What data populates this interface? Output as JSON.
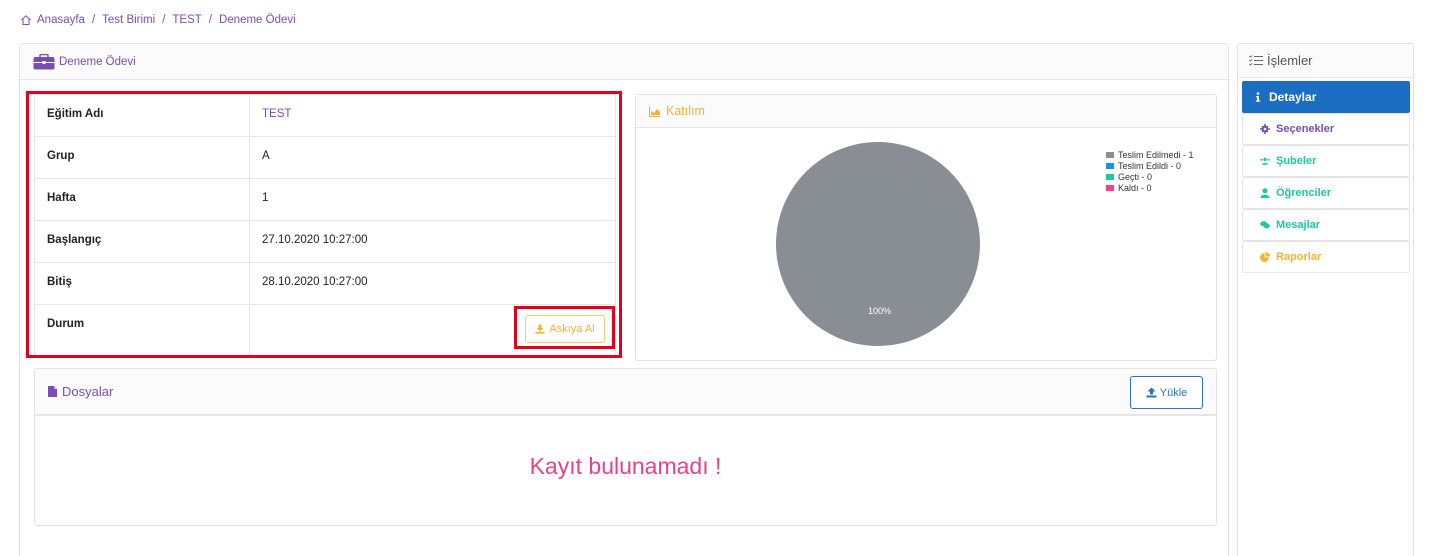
{
  "breadcrumb": {
    "items": [
      "Anasayfa",
      "Test Birimi",
      "TEST",
      "Deneme Ödevi"
    ],
    "separator": "/"
  },
  "main": {
    "title": "Deneme Ödevi",
    "details": [
      {
        "label": "Eğitim Adı",
        "value": "TEST"
      },
      {
        "label": "Grup",
        "value": "A"
      },
      {
        "label": "Hafta",
        "value": "1"
      },
      {
        "label": "Başlangıç",
        "value": "27.10.2020 10:27:00"
      },
      {
        "label": "Bitiş",
        "value": "28.10.2020 10:27:00"
      },
      {
        "label": "Durum",
        "value": ""
      }
    ],
    "suspend_button": "Askıya Al"
  },
  "participation": {
    "title": "Katılım",
    "pie_label": "100%",
    "legend": [
      {
        "label": "Teslim Edilmedi - 1",
        "color": "#888e93"
      },
      {
        "label": "Teslim Edildi - 0",
        "color": "#1e8ff0"
      },
      {
        "label": "Geçti - 0",
        "color": "#1ec8a0"
      },
      {
        "label": "Kaldı - 0",
        "color": "#f43e9c"
      }
    ]
  },
  "chart_data": {
    "type": "pie",
    "categories": [
      "Teslim Edilmedi",
      "Teslim Edildi",
      "Geçti",
      "Kaldı"
    ],
    "values": [
      1,
      0,
      0,
      0
    ],
    "title": "Katılım",
    "legend_position": "top-right"
  },
  "files": {
    "title": "Dosyalar",
    "upload_button": "Yükle",
    "empty_message": "Kayıt bulunamadı !"
  },
  "sidebar": {
    "title": "İşlemler",
    "items": [
      {
        "label": "Detaylar",
        "icon": "info-icon",
        "color": "#ffffff"
      },
      {
        "label": "Seçenekler",
        "icon": "gear-icon",
        "color": "#7a4db3"
      },
      {
        "label": "Şubeler",
        "icon": "users-icon",
        "color": "#1ec8a0"
      },
      {
        "label": "Öğrenciler",
        "icon": "user-icon",
        "color": "#1ec8a0"
      },
      {
        "label": "Mesajlar",
        "icon": "comments-icon",
        "color": "#1ec8a0"
      },
      {
        "label": "Raporlar",
        "icon": "pie-chart-icon",
        "color": "#f5b230"
      }
    ]
  }
}
